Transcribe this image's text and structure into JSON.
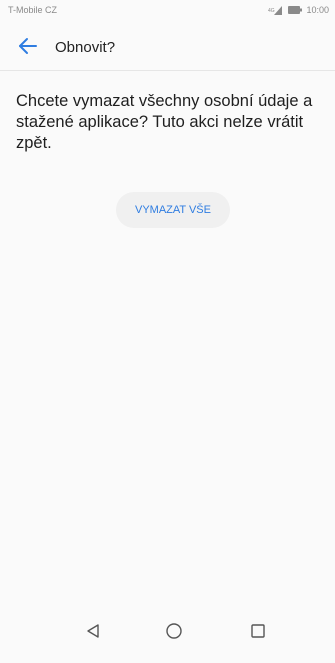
{
  "status_bar": {
    "carrier": "T-Mobile CZ",
    "time": "10:00",
    "signal_icon": "signal-icon",
    "battery_icon": "battery-icon"
  },
  "app_bar": {
    "title": "Obnovit?",
    "back_icon": "arrow-left-icon"
  },
  "content": {
    "message": "Chcete vymazat všechny osobní údaje a stažené aplikace? Tuto akci nelze vrátit zpět.",
    "erase_button_label": "VYMAZAT VŠE"
  },
  "navigation_bar": {
    "back_icon": "triangle-back-icon",
    "home_icon": "circle-home-icon",
    "recents_icon": "square-recents-icon"
  },
  "colors": {
    "accent": "#2f7de1",
    "background": "#fafafa",
    "text": "#1f1f1f",
    "button_background": "#f0f0f0"
  }
}
